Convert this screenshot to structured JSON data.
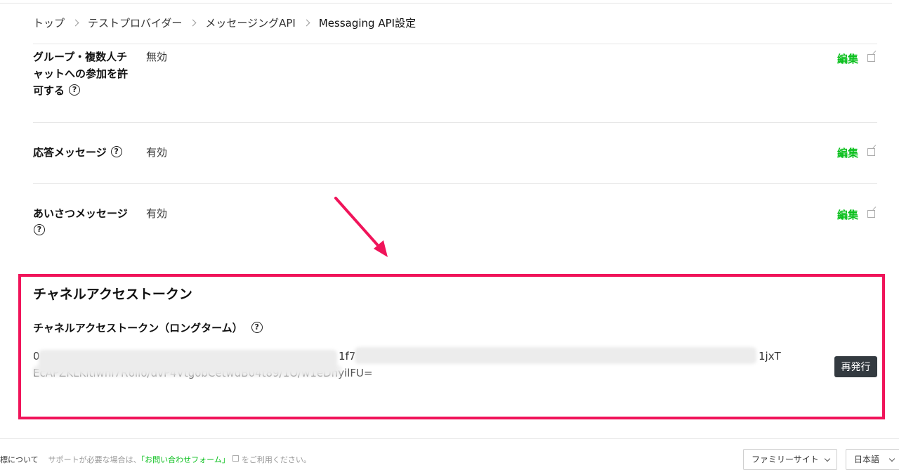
{
  "breadcrumb": {
    "items": [
      "トップ",
      "テストプロバイダー",
      "メッセージングAPI",
      "Messaging API設定"
    ]
  },
  "settings": {
    "rows": [
      {
        "label_lines": [
          "グループ・複数人チ",
          "ャットへの参加を許",
          "可する"
        ],
        "value": "無効",
        "edit_label": "編集"
      },
      {
        "label": "応答メッセージ",
        "value": "有効",
        "edit_label": "編集"
      },
      {
        "label_line1": "あいさつメッセージ",
        "value": "有効",
        "edit_label": "編集"
      }
    ]
  },
  "token": {
    "heading": "チャネルアクセストークン",
    "sub_heading": "チャネルアクセストークン（ロングターム）",
    "line1_start": "0",
    "line1_mid": "1f7",
    "line1_end": "1jxT",
    "line2": "EcAPZKLKitiwni7R6llo/dvP4VtgobCetwdB04t89/1O/w1eDnyilFU=",
    "reissue_label": "再発行"
  },
  "footer": {
    "first": "標について",
    "support_text": "サポートが必要な場合は、",
    "link": "「お問い合わせフォーム」",
    "tail": "をご利用ください。",
    "family_site": "ファミリーサイト",
    "language": "日本語"
  },
  "colors": {
    "accent_green": "#08bf1b",
    "highlight_red": "#f0145a",
    "button_dark": "#333a40"
  }
}
